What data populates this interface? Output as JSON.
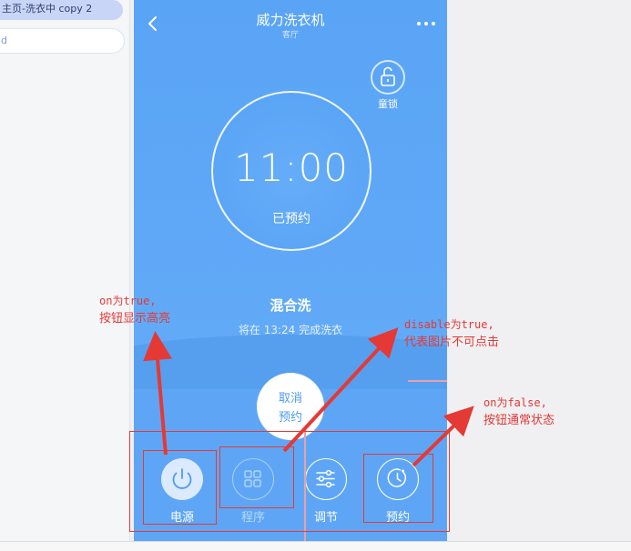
{
  "sidebar": {
    "active_item": "主页-洗衣中 copy 2",
    "search_value": "d"
  },
  "device": {
    "title": "威力洗衣机",
    "room": "客厅",
    "child_lock_label": "童锁",
    "timer": {
      "time": "11:00",
      "status": "已预约"
    },
    "program_name": "混合洗",
    "finish_text": "将在 13:24 完成洗衣",
    "cancel_button": {
      "line1": "取消",
      "line2": "预约"
    },
    "controls": [
      {
        "id": "power",
        "label": "电源",
        "icon": "power-icon",
        "state": "on"
      },
      {
        "id": "program",
        "label": "程序",
        "icon": "grid-icon",
        "state": "disabled"
      },
      {
        "id": "adjust",
        "label": "调节",
        "icon": "sliders-icon",
        "state": "normal"
      },
      {
        "id": "reserve",
        "label": "预约",
        "icon": "clock-icon",
        "state": "normal"
      }
    ]
  },
  "annotations": {
    "on_true": {
      "line1": "on为true,",
      "line2": "按钮显示高亮"
    },
    "disable_true": {
      "line1": "disable为true,",
      "line2": "代表图片不可点击"
    },
    "on_false": {
      "line1": "on为false,",
      "line2": "按钮通常状态"
    }
  },
  "colors": {
    "background_blue": "#5ea6f5",
    "annotation_red": "#e53935",
    "highlight_circle": "#dceaff"
  }
}
